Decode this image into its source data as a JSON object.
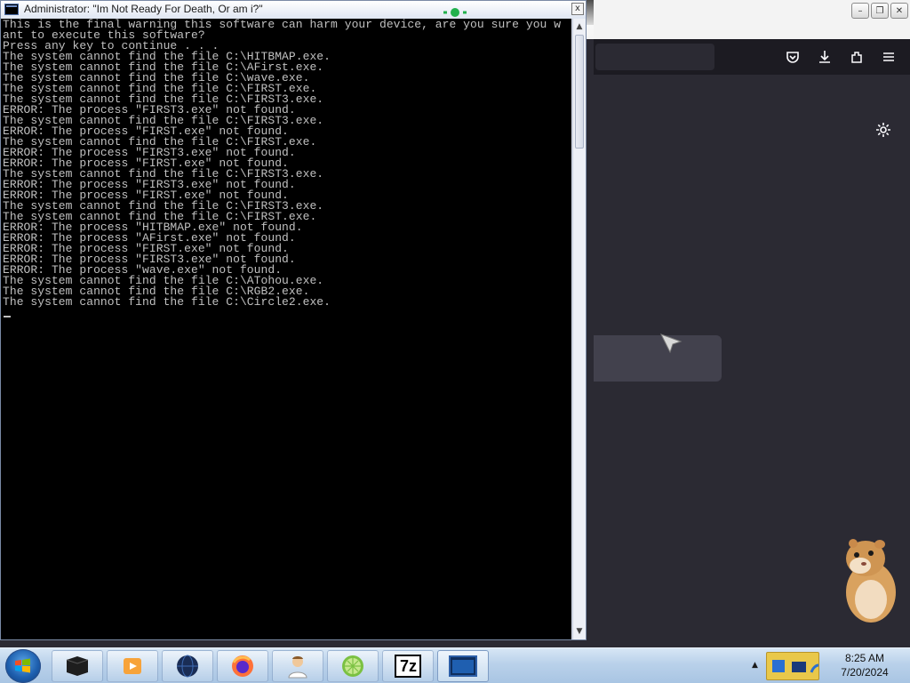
{
  "console": {
    "title": "Administrator:  \"Im Not Ready For Death, Or am i?\"",
    "close_label": "x",
    "lines": [
      "This is the final warning this software can harm your device, are you sure you w",
      "ant to execute this software?",
      "Press any key to continue . . .",
      "The system cannot find the file C:\\HITBMAP.exe.",
      "The system cannot find the file C:\\AFirst.exe.",
      "The system cannot find the file C:\\wave.exe.",
      "The system cannot find the file C:\\FIRST.exe.",
      "The system cannot find the file C:\\FIRST3.exe.",
      "ERROR: The process \"FIRST3.exe\" not found.",
      "The system cannot find the file C:\\FIRST3.exe.",
      "ERROR: The process \"FIRST.exe\" not found.",
      "The system cannot find the file C:\\FIRST.exe.",
      "ERROR: The process \"FIRST3.exe\" not found.",
      "ERROR: The process \"FIRST.exe\" not found.",
      "The system cannot find the file C:\\FIRST3.exe.",
      "ERROR: The process \"FIRST3.exe\" not found.",
      "ERROR: The process \"FIRST.exe\" not found.",
      "The system cannot find the file C:\\FIRST3.exe.",
      "The system cannot find the file C:\\FIRST.exe.",
      "ERROR: The process \"HITBMAP.exe\" not found.",
      "ERROR: The process \"AFirst.exe\" not found.",
      "ERROR: The process \"FIRST.exe\" not found.",
      "ERROR: The process \"FIRST3.exe\" not found.",
      "ERROR: The process \"wave.exe\" not found.",
      "The system cannot find the file C:\\ATohou.exe.",
      "The system cannot find the file C:\\RGB2.exe.",
      "The system cannot find the file C:\\Circle2.exe."
    ]
  },
  "firefox": {
    "window_controls": [
      "minimize",
      "restore",
      "close"
    ],
    "toolbar_icons": [
      "pocket-icon",
      "download-icon",
      "extensions-icon",
      "menu-icon"
    ]
  },
  "taskbar": {
    "items": [
      {
        "name": "taskbar-item-terminal",
        "icon": "terminal-icon"
      },
      {
        "name": "taskbar-item-media",
        "icon": "media-player-icon"
      },
      {
        "name": "taskbar-item-globe",
        "icon": "globe-icon"
      },
      {
        "name": "taskbar-item-firefox",
        "icon": "firefox-icon"
      },
      {
        "name": "taskbar-item-user",
        "icon": "user-icon"
      },
      {
        "name": "taskbar-item-citrus",
        "icon": "citrus-icon"
      },
      {
        "name": "taskbar-item-7zip",
        "icon": "7zip-icon",
        "label": "7z"
      },
      {
        "name": "taskbar-item-console",
        "icon": "console-icon"
      }
    ],
    "clock": {
      "time": "8:25 AM",
      "date": "7/20/2024"
    },
    "tray_arrow": "▲"
  },
  "colors": {
    "console_bg": "#000000",
    "console_text": "#c0c0c0",
    "firefox_bg": "#2b2a33",
    "firefox_toolbar": "#1c1b22",
    "taskbar_top": "#d7e6f5"
  }
}
